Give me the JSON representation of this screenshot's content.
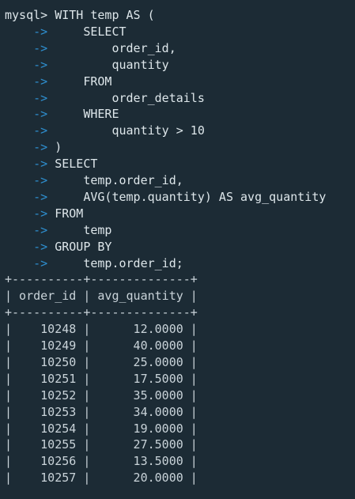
{
  "terminal": {
    "prompt": "mysql>",
    "continuation": "->",
    "query_lines": [
      "WITH temp AS (",
      "    SELECT",
      "        order_id,",
      "        quantity",
      "    FROM",
      "        order_details",
      "    WHERE",
      "        quantity > 10",
      ")",
      "SELECT",
      "    temp.order_id,",
      "    AVG(temp.quantity) AS avg_quantity",
      "FROM",
      "    temp",
      "GROUP BY",
      "    temp.order_id;"
    ],
    "result": {
      "border": "+----------+--------------+",
      "header": "| order_id | avg_quantity |",
      "columns": [
        "order_id",
        "avg_quantity"
      ],
      "rows": [
        [
          "10248",
          "12.0000"
        ],
        [
          "10249",
          "40.0000"
        ],
        [
          "10250",
          "25.0000"
        ],
        [
          "10251",
          "17.5000"
        ],
        [
          "10252",
          "35.0000"
        ],
        [
          "10253",
          "34.0000"
        ],
        [
          "10254",
          "19.0000"
        ],
        [
          "10255",
          "27.5000"
        ],
        [
          "10256",
          "13.5000"
        ],
        [
          "10257",
          "20.0000"
        ]
      ]
    },
    "colors": {
      "background": "#1c2b35",
      "text": "#dde6ea",
      "arrow": "#2e8fd0"
    }
  }
}
